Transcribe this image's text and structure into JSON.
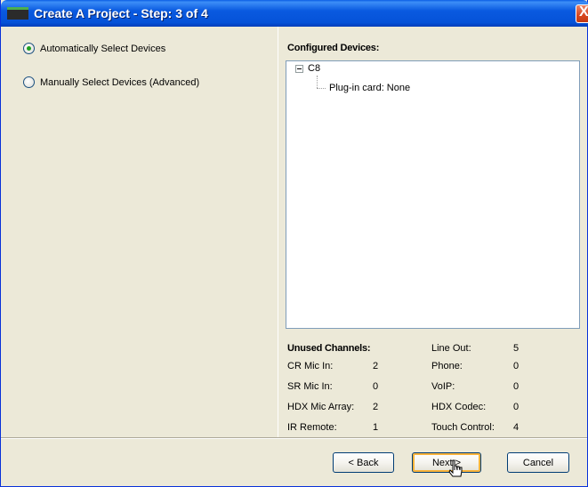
{
  "window": {
    "title": "Create A Project - Step: 3 of 4",
    "close_label": "X"
  },
  "options": {
    "auto_label": "Automatically Select Devices",
    "manual_label": "Manually Select Devices (Advanced)",
    "selected": "auto"
  },
  "configured": {
    "title": "Configured Devices:",
    "root_label": "C8",
    "child_label": "Plug-in card: None"
  },
  "unused": {
    "title": "Unused Channels:",
    "left": [
      {
        "label": "CR Mic In:",
        "value": "2"
      },
      {
        "label": "SR Mic In:",
        "value": "0"
      },
      {
        "label": "HDX Mic Array:",
        "value": "2"
      },
      {
        "label": "IR Remote:",
        "value": "1"
      }
    ],
    "right": [
      {
        "label": "Line Out:",
        "value": "5"
      },
      {
        "label": "Phone:",
        "value": "0"
      },
      {
        "label": "VoIP:",
        "value": "0"
      },
      {
        "label": "HDX Codec:",
        "value": "0"
      },
      {
        "label": "Touch Control:",
        "value": "4"
      }
    ]
  },
  "buttons": {
    "back": "< Back",
    "next": "Next >",
    "cancel": "Cancel"
  },
  "colors": {
    "titlebar": "#0A5AE0",
    "face": "#ECE9D8",
    "radio_dot": "#21A121"
  }
}
